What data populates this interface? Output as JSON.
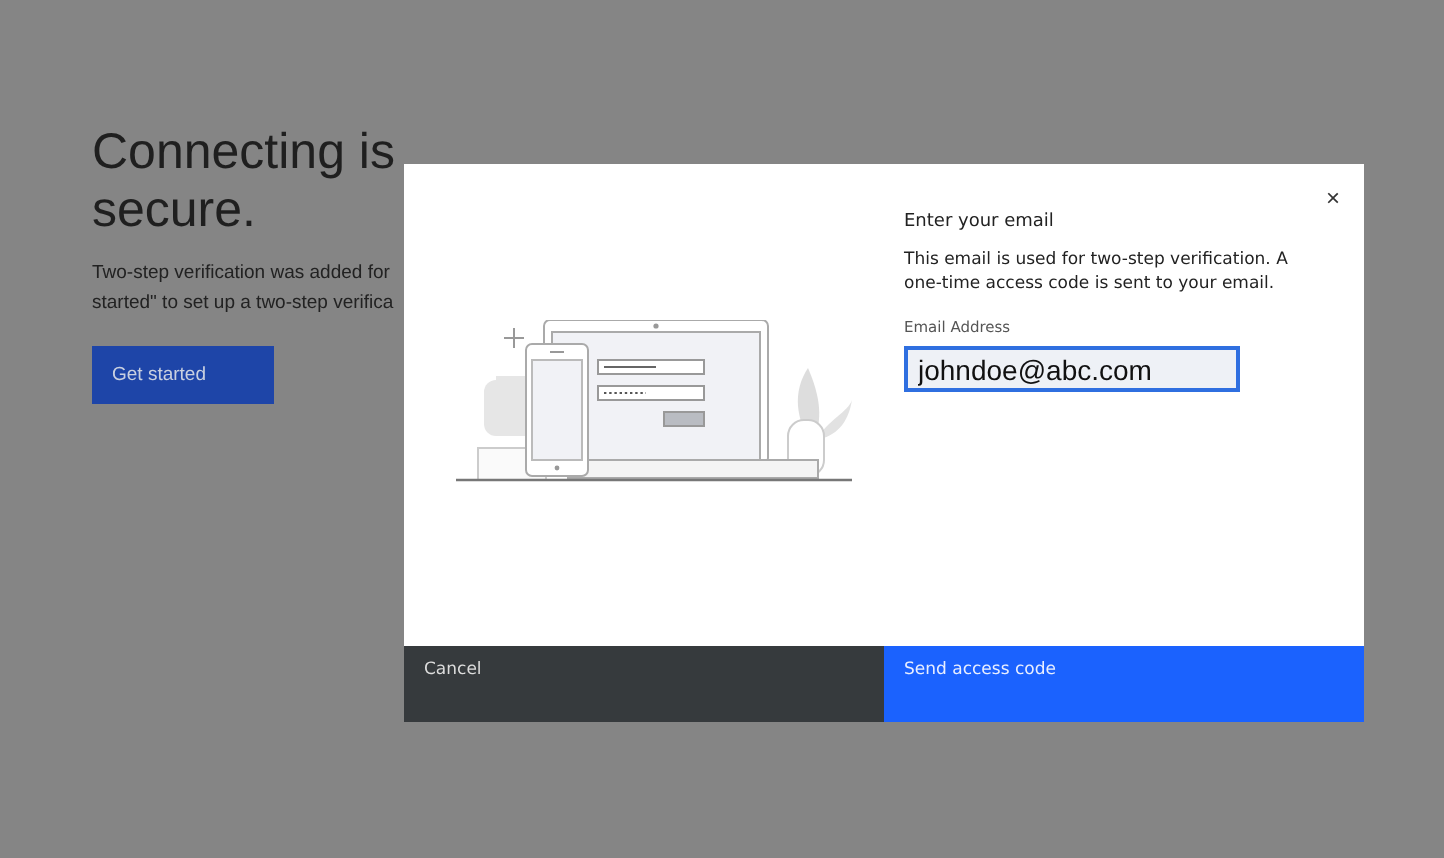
{
  "page": {
    "heading_lines": [
      "Connecting is",
      "secure."
    ],
    "body_lines": [
      "Two-step verification was added for",
      "started\" to set up a two-step verifica"
    ],
    "button": "Get started"
  },
  "dialog": {
    "close": "×",
    "title": "Enter your email",
    "description": "This email is used for two-step verification. A one-time access code is sent to your email.",
    "field": {
      "label": "Email Address",
      "value": "johndoe@abc.com",
      "focused": true
    },
    "buttons": [
      {
        "label": "Cancel",
        "kind": "secondary"
      },
      {
        "label": "Send access code",
        "kind": "primary"
      }
    ]
  }
}
